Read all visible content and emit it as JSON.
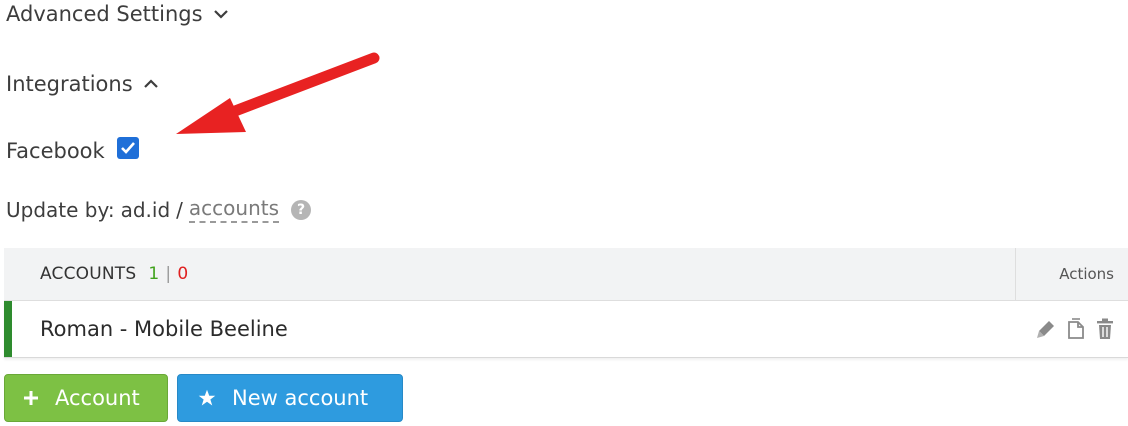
{
  "sections": {
    "advanced_settings": "Advanced Settings",
    "integrations": "Integrations"
  },
  "facebook": {
    "label": "Facebook",
    "checked": true
  },
  "update_by": {
    "label": "Update by:",
    "value": "ad.id",
    "separator": "/",
    "link": "accounts"
  },
  "table": {
    "header": {
      "accounts_label": "ACCOUNTS",
      "count_active": "1",
      "count_separator": "|",
      "count_inactive": "0",
      "actions_label": "Actions"
    },
    "rows": [
      {
        "name": "Roman - Mobile Beeline",
        "status": "active"
      }
    ],
    "row_actions": [
      "pencil-icon",
      "copy-icon",
      "trash-icon"
    ]
  },
  "buttons": {
    "add_account": {
      "label": "Account",
      "icon": "plus-icon"
    },
    "new_account": {
      "label": "New account",
      "icon": "star-icon"
    }
  },
  "colors": {
    "checkbox": "#1f6fd8",
    "count_active": "#41a21d",
    "count_inactive": "#e02020",
    "status_active": "#2e8b2e",
    "add_button": "#7dc144",
    "new_button": "#2e9bdf",
    "annotation_arrow": "#e82222"
  }
}
